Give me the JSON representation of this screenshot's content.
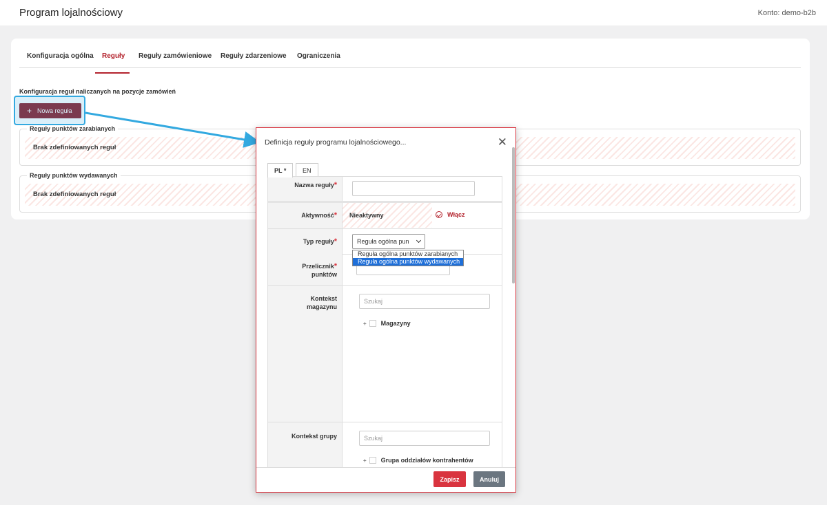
{
  "header": {
    "title": "Program lojalnościowy",
    "account": "Konto: demo-b2b"
  },
  "tabs": [
    {
      "label": "Konfiguracja ogólna"
    },
    {
      "label": "Reguły"
    },
    {
      "label": "Reguły zamówieniowe"
    },
    {
      "label": "Reguły zdarzeniowe"
    },
    {
      "label": "Ograniczenia"
    }
  ],
  "main": {
    "section_title": "Konfiguracja reguł naliczanych na pozycje zamówień",
    "new_rule_button": "Nowa reguła",
    "earned": {
      "legend": "Reguły punktów zarabianych",
      "empty": "Brak zdefiniowanych reguł"
    },
    "spent": {
      "legend": "Reguły punktów wydawanych",
      "empty": "Brak zdefiniowanych reguł"
    }
  },
  "colors": {
    "accent": "#b3222c",
    "highlight": "#33a9e0",
    "danger": "#d9343f",
    "secondary": "#6b7680"
  },
  "modal": {
    "title": "Definicja reguły programu lojalnościowego...",
    "lang_tabs": [
      "PL *",
      "EN"
    ],
    "fields": {
      "name": {
        "label": "Nazwa reguły",
        "value": ""
      },
      "activity": {
        "label": "Aktywność",
        "status": "Nieaktywny",
        "toggle": "Włącz"
      },
      "type": {
        "label": "Typ reguły",
        "selected": "Reguła ogólna pun",
        "options": [
          "Reguła ogólna punktów zarabianych",
          "Reguła ogólna punktów wydawanych"
        ]
      },
      "converter": {
        "label_line1": "Przelicznik",
        "label_line2": "punktów"
      },
      "warehouse": {
        "label_line1": "Kontekst",
        "label_line2": "magazynu",
        "search_placeholder": "Szukaj",
        "tree_root": "Magazyny"
      },
      "group": {
        "label": "Kontekst grupy",
        "search_placeholder": "Szukaj",
        "tree_root": "Grupa oddziałów kontrahentów"
      }
    },
    "save": "Zapisz",
    "cancel": "Anuluj"
  }
}
